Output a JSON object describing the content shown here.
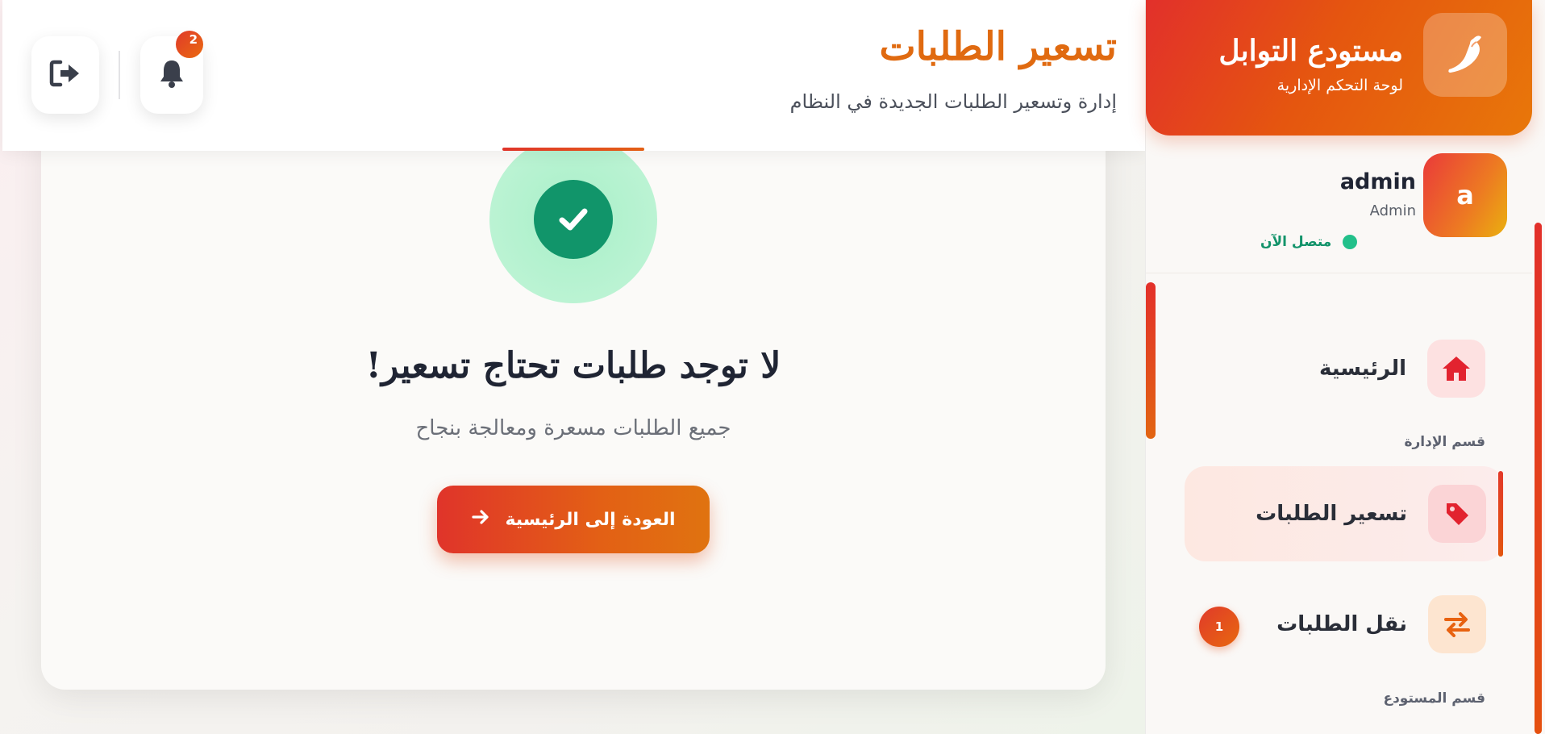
{
  "header": {
    "title": "تسعير الطلبات",
    "subtitle": "إدارة وتسعير الطلبات الجديدة في النظام",
    "notifications_count": "2"
  },
  "empty_state": {
    "title": "لا توجد طلبات تحتاج تسعير!",
    "subtitle": "جميع الطلبات مسعرة ومعالجة بنجاح",
    "back_button_label": "العودة إلى الرئيسية"
  },
  "sidebar": {
    "brand_name": "مستودع التوابل",
    "brand_subtitle": "لوحة التحكم الإدارية",
    "user": {
      "avatar_letter": "a",
      "name": "admin",
      "role": "Admin",
      "status": "متصل الآن"
    },
    "nav": {
      "home_label": "الرئيسية",
      "section_admin": "قسم الإدارة",
      "pricing_label": "تسعير الطلبات",
      "transfer_label": "نقل الطلبات",
      "transfer_badge": "1",
      "section_warehouse": "قسم المستودع"
    }
  },
  "colors": {
    "accent": "#e36015",
    "accent_red": "#e0342a",
    "success": "#11956a",
    "title_orange": "#e06a10"
  },
  "icons": {
    "brand": "chili-pepper-icon",
    "home": "home-icon",
    "pricing": "tag-icon",
    "transfer": "exchange-arrows-icon",
    "notifications": "bell-icon",
    "logout": "logout-icon",
    "success": "check-circle-icon",
    "back": "arrow-right-icon"
  }
}
